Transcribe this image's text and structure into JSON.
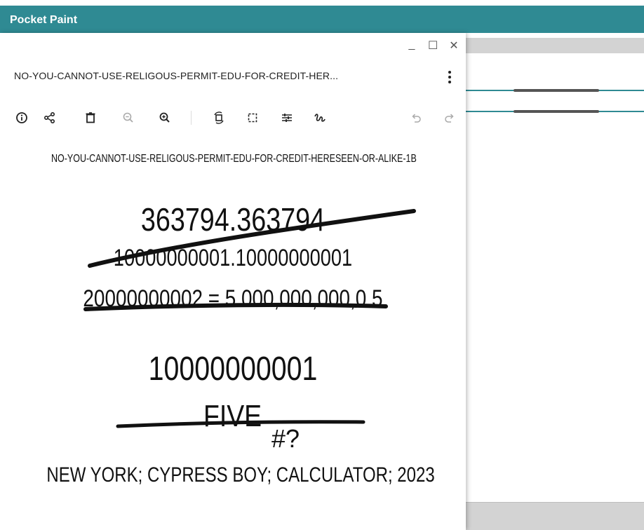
{
  "app": {
    "title": "Pocket Paint"
  },
  "window": {
    "minimize": "_",
    "maximize": "☐",
    "close": "✕"
  },
  "viewer": {
    "title": "NO-YOU-CANNOT-USE-RELIGOUS-PERMIT-EDU-FOR-CREDIT-HER...",
    "toolbar": [
      {
        "name": "info-icon"
      },
      {
        "name": "share-icon"
      },
      {
        "name": "delete-icon"
      },
      {
        "name": "zoom-out-icon",
        "disabled": true
      },
      {
        "name": "zoom-in-icon"
      },
      {
        "name": "rotate-icon"
      },
      {
        "name": "crop-icon"
      },
      {
        "name": "adjust-icon"
      },
      {
        "name": "markup-icon"
      },
      {
        "name": "undo-icon",
        "disabled": true
      },
      {
        "name": "redo-icon",
        "disabled": true
      }
    ]
  },
  "image": {
    "header": "NO-YOU-CANNOT-USE-RELIGOUS-PERMIT-EDU-FOR-CREDIT-HERESEEN-OR-ALIKE-1B",
    "line1": "363794.363794",
    "line2": "10000000001.10000000001",
    "line3": "20000000002 = 5 000,000,000,0 5",
    "numerator": "10000000001",
    "denominator": "FIVE",
    "subscript": "#?",
    "footer": "NEW YORK; CYPRESS BOY; CALCULATOR; 2023"
  },
  "colors": {
    "app_bar": "#2f8a93",
    "ink": "#111111"
  }
}
